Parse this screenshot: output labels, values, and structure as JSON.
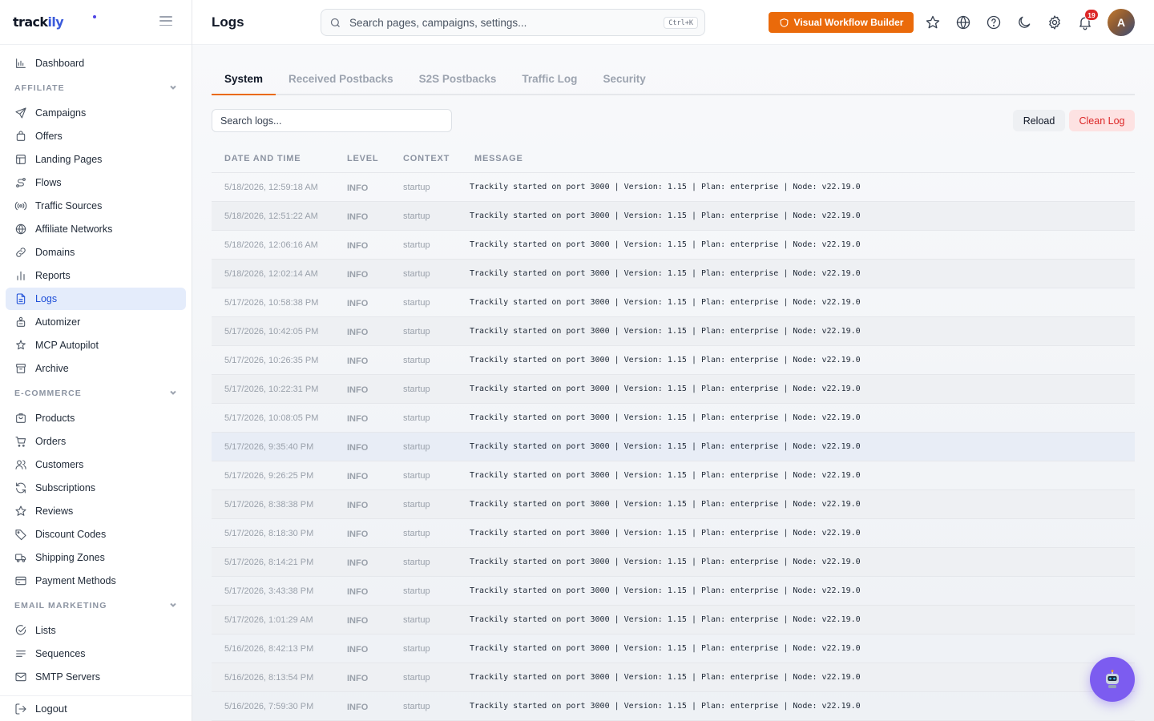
{
  "brand": {
    "name_a": "track",
    "name_b": "ily"
  },
  "sidebar": {
    "items_top": [
      {
        "label": "Dashboard",
        "icon": "chart-bar-icon"
      }
    ],
    "sections": [
      {
        "title": "AFFILIATE",
        "items": [
          {
            "label": "Campaigns",
            "icon": "send-icon"
          },
          {
            "label": "Offers",
            "icon": "bag-icon"
          },
          {
            "label": "Landing Pages",
            "icon": "layout-icon"
          },
          {
            "label": "Flows",
            "icon": "route-icon"
          },
          {
            "label": "Traffic Sources",
            "icon": "broadcast-icon"
          },
          {
            "label": "Affiliate Networks",
            "icon": "globe-icon"
          },
          {
            "label": "Domains",
            "icon": "link-icon"
          },
          {
            "label": "Reports",
            "icon": "bar-chart-icon"
          },
          {
            "label": "Logs",
            "icon": "document-icon",
            "active": true
          },
          {
            "label": "Automizer",
            "icon": "robot-icon"
          },
          {
            "label": "MCP Autopilot",
            "icon": "sparkle-icon"
          },
          {
            "label": "Archive",
            "icon": "archive-icon"
          }
        ]
      },
      {
        "title": "E-COMMERCE",
        "items": [
          {
            "label": "Products",
            "icon": "package-icon"
          },
          {
            "label": "Orders",
            "icon": "cart-icon"
          },
          {
            "label": "Customers",
            "icon": "users-icon"
          },
          {
            "label": "Subscriptions",
            "icon": "refresh-icon"
          },
          {
            "label": "Reviews",
            "icon": "star-icon"
          },
          {
            "label": "Discount Codes",
            "icon": "tag-icon"
          },
          {
            "label": "Shipping Zones",
            "icon": "truck-icon"
          },
          {
            "label": "Payment Methods",
            "icon": "credit-card-icon"
          }
        ]
      },
      {
        "title": "EMAIL MARKETING",
        "items": [
          {
            "label": "Lists",
            "icon": "check-circle-icon"
          },
          {
            "label": "Sequences",
            "icon": "lines-icon"
          },
          {
            "label": "SMTP Servers",
            "icon": "mail-icon"
          }
        ]
      }
    ],
    "logout": "Logout"
  },
  "header": {
    "title": "Logs",
    "search_placeholder": "Search pages, campaigns, settings...",
    "shortcut": "Ctrl+K",
    "workflow_button": "Visual Workflow Builder",
    "notifications": "19",
    "avatar": "A"
  },
  "tabs": [
    "System",
    "Received Postbacks",
    "S2S Postbacks",
    "Traffic Log",
    "Security"
  ],
  "toolbar": {
    "search_placeholder": "Search logs...",
    "reload": "Reload",
    "clean": "Clean Log"
  },
  "table": {
    "columns": [
      "DATE AND TIME",
      "LEVEL",
      "CONTEXT",
      "MESSAGE"
    ],
    "rows": [
      [
        "5/18/2026, 12:59:18 AM",
        "INFO",
        "startup",
        "Trackily started on port 3000 | Version: 1.15 | Plan: enterprise | Node: v22.19.0"
      ],
      [
        "5/18/2026, 12:51:22 AM",
        "INFO",
        "startup",
        "Trackily started on port 3000 | Version: 1.15 | Plan: enterprise | Node: v22.19.0"
      ],
      [
        "5/18/2026, 12:06:16 AM",
        "INFO",
        "startup",
        "Trackily started on port 3000 | Version: 1.15 | Plan: enterprise | Node: v22.19.0"
      ],
      [
        "5/18/2026, 12:02:14 AM",
        "INFO",
        "startup",
        "Trackily started on port 3000 | Version: 1.15 | Plan: enterprise | Node: v22.19.0"
      ],
      [
        "5/17/2026, 10:58:38 PM",
        "INFO",
        "startup",
        "Trackily started on port 3000 | Version: 1.15 | Plan: enterprise | Node: v22.19.0"
      ],
      [
        "5/17/2026, 10:42:05 PM",
        "INFO",
        "startup",
        "Trackily started on port 3000 | Version: 1.15 | Plan: enterprise | Node: v22.19.0"
      ],
      [
        "5/17/2026, 10:26:35 PM",
        "INFO",
        "startup",
        "Trackily started on port 3000 | Version: 1.15 | Plan: enterprise | Node: v22.19.0"
      ],
      [
        "5/17/2026, 10:22:31 PM",
        "INFO",
        "startup",
        "Trackily started on port 3000 | Version: 1.15 | Plan: enterprise | Node: v22.19.0"
      ],
      [
        "5/17/2026, 10:08:05 PM",
        "INFO",
        "startup",
        "Trackily started on port 3000 | Version: 1.15 | Plan: enterprise | Node: v22.19.0"
      ],
      [
        "5/17/2026, 9:35:40 PM",
        "INFO",
        "startup",
        "Trackily started on port 3000 | Version: 1.15 | Plan: enterprise | Node: v22.19.0"
      ],
      [
        "5/17/2026, 9:26:25 PM",
        "INFO",
        "startup",
        "Trackily started on port 3000 | Version: 1.15 | Plan: enterprise | Node: v22.19.0"
      ],
      [
        "5/17/2026, 8:38:38 PM",
        "INFO",
        "startup",
        "Trackily started on port 3000 | Version: 1.15 | Plan: enterprise | Node: v22.19.0"
      ],
      [
        "5/17/2026, 8:18:30 PM",
        "INFO",
        "startup",
        "Trackily started on port 3000 | Version: 1.15 | Plan: enterprise | Node: v22.19.0"
      ],
      [
        "5/17/2026, 8:14:21 PM",
        "INFO",
        "startup",
        "Trackily started on port 3000 | Version: 1.15 | Plan: enterprise | Node: v22.19.0"
      ],
      [
        "5/17/2026, 3:43:38 PM",
        "INFO",
        "startup",
        "Trackily started on port 3000 | Version: 1.15 | Plan: enterprise | Node: v22.19.0"
      ],
      [
        "5/17/2026, 1:01:29 AM",
        "INFO",
        "startup",
        "Trackily started on port 3000 | Version: 1.15 | Plan: enterprise | Node: v22.19.0"
      ],
      [
        "5/16/2026, 8:42:13 PM",
        "INFO",
        "startup",
        "Trackily started on port 3000 | Version: 1.15 | Plan: enterprise | Node: v22.19.0"
      ],
      [
        "5/16/2026, 8:13:54 PM",
        "INFO",
        "startup",
        "Trackily started on port 3000 | Version: 1.15 | Plan: enterprise | Node: v22.19.0"
      ],
      [
        "5/16/2026, 7:59:30 PM",
        "INFO",
        "startup",
        "Trackily started on port 3000 | Version: 1.15 | Plan: enterprise | Node: v22.19.0"
      ]
    ],
    "highlight_row": 9
  },
  "colors": {
    "accent": "#ea6a0a",
    "active_nav": "#1d4ed8",
    "danger": "#dc2626",
    "bot": "#7c5cf0"
  }
}
